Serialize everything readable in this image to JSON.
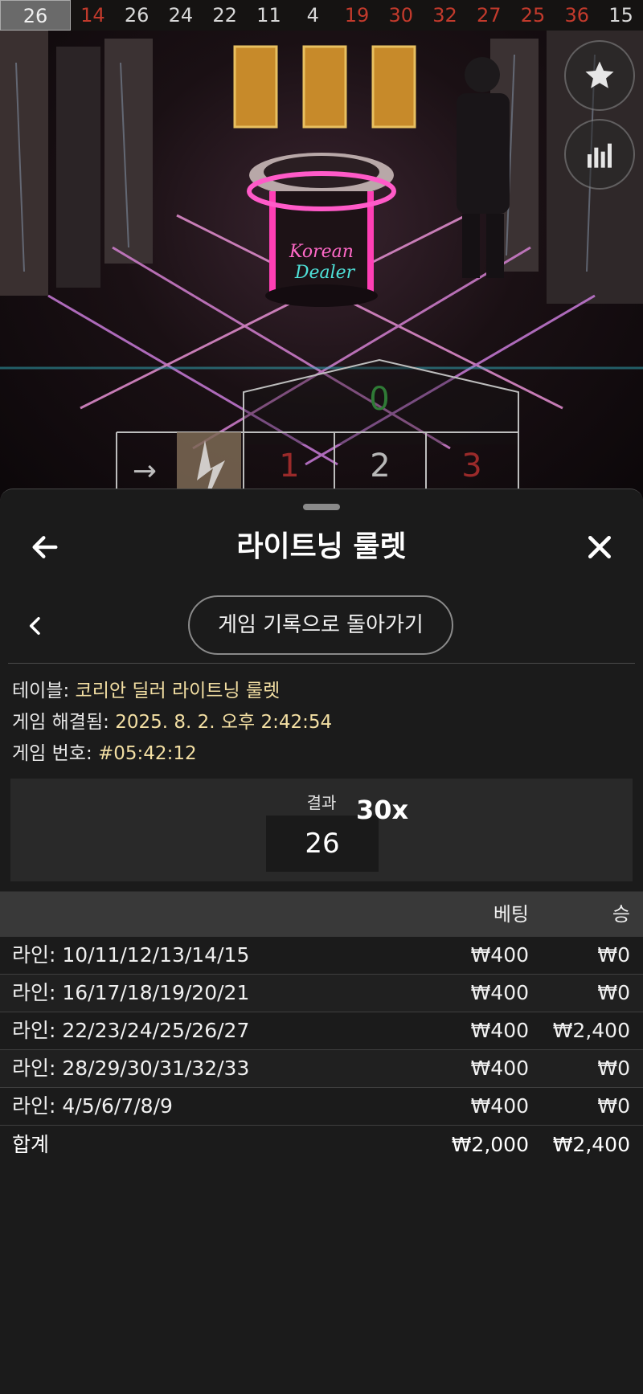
{
  "history": {
    "current": "26",
    "numbers": [
      {
        "n": "14",
        "color": "red"
      },
      {
        "n": "26",
        "color": "black"
      },
      {
        "n": "24",
        "color": "black"
      },
      {
        "n": "22",
        "color": "black"
      },
      {
        "n": "11",
        "color": "black"
      },
      {
        "n": "4",
        "color": "black"
      },
      {
        "n": "19",
        "color": "red"
      },
      {
        "n": "30",
        "color": "red"
      },
      {
        "n": "32",
        "color": "red"
      },
      {
        "n": "27",
        "color": "red"
      },
      {
        "n": "25",
        "color": "red"
      },
      {
        "n": "36",
        "color": "red"
      },
      {
        "n": "15",
        "color": "black"
      }
    ]
  },
  "scene": {
    "neon_sign_line1": "Korean",
    "neon_sign_line2": "Dealer",
    "board": {
      "zero": "0",
      "n1": "1",
      "n2": "2",
      "n3": "3"
    }
  },
  "side_buttons": {
    "favorite_icon": "star-icon",
    "stats_icon": "bar-chart-icon"
  },
  "sheet": {
    "title": "라이트닝 룰렛",
    "back_to_history": "게임 기록으로 돌아가기",
    "info": {
      "table_label": "테이블:",
      "table_value": "코리안 딜러 라이트닝 룰렛",
      "resolved_label": "게임 해결됨:",
      "resolved_value": "2025. 8. 2. 오후 2:42:54",
      "number_label": "게임 번호:",
      "number_value": "#05:42:12"
    },
    "result": {
      "label": "결과",
      "value": "26",
      "multiplier": "30x"
    },
    "table": {
      "col_bet": "베팅",
      "col_win": "승",
      "rows": [
        {
          "label": "라인: 10/11/12/13/14/15",
          "bet": "₩400",
          "win": "₩0"
        },
        {
          "label": "라인: 16/17/18/19/20/21",
          "bet": "₩400",
          "win": "₩0"
        },
        {
          "label": "라인: 22/23/24/25/26/27",
          "bet": "₩400",
          "win": "₩2,400"
        },
        {
          "label": "라인: 28/29/30/31/32/33",
          "bet": "₩400",
          "win": "₩0"
        },
        {
          "label": "라인: 4/5/6/7/8/9",
          "bet": "₩400",
          "win": "₩0"
        }
      ],
      "total": {
        "label": "합계",
        "bet": "₩2,000",
        "win": "₩2,400"
      }
    }
  },
  "colors": {
    "red": "#c23a2c",
    "black": "#d8d8d8",
    "accent_text": "#f3dfa3",
    "sheet_bg": "#1b1b1b"
  }
}
